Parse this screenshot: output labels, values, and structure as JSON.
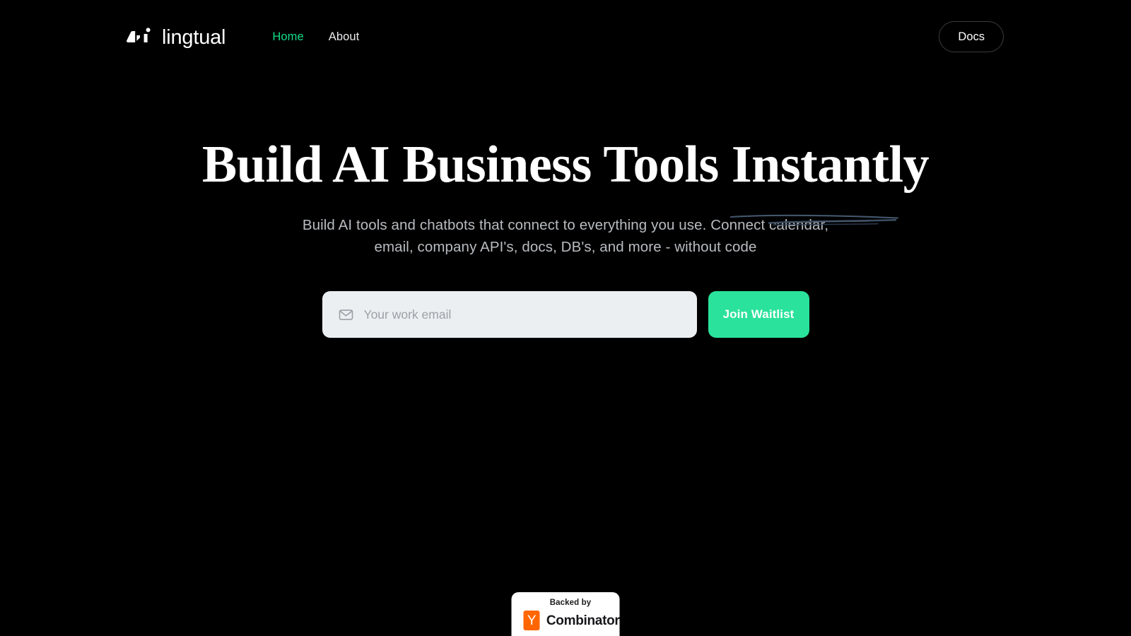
{
  "theme": {
    "background": "#000000",
    "accent_green": "#2ae29b",
    "nav_active_green": "#13dd88",
    "input_background": "#eceff2",
    "scribble_color": "#3d4e61",
    "yc_orange": "#ff6600"
  },
  "nav": {
    "brand_name": "lingtual",
    "brand_mark_icon": "lingtual-logo-icon",
    "links": [
      {
        "label": "Home",
        "active": true
      },
      {
        "label": "About",
        "active": false
      }
    ],
    "docs_label": "Docs"
  },
  "hero": {
    "headline_prefix": "Build AI Business Tools ",
    "headline_accent": "Instantly",
    "subtitle_line_1": "Build AI tools and chatbots that connect to everything you use. Connect calendar,",
    "subtitle_line_2": "email, company API's, docs, DB's, and more - without code"
  },
  "signup": {
    "mail_icon": "envelope-icon",
    "email_placeholder": "Your work email",
    "email_value": "",
    "submit_label": "Join Waitlist"
  },
  "yc_badge": {
    "top_text": "Backed by",
    "logo_letter": "Y",
    "name": "Combinator"
  }
}
